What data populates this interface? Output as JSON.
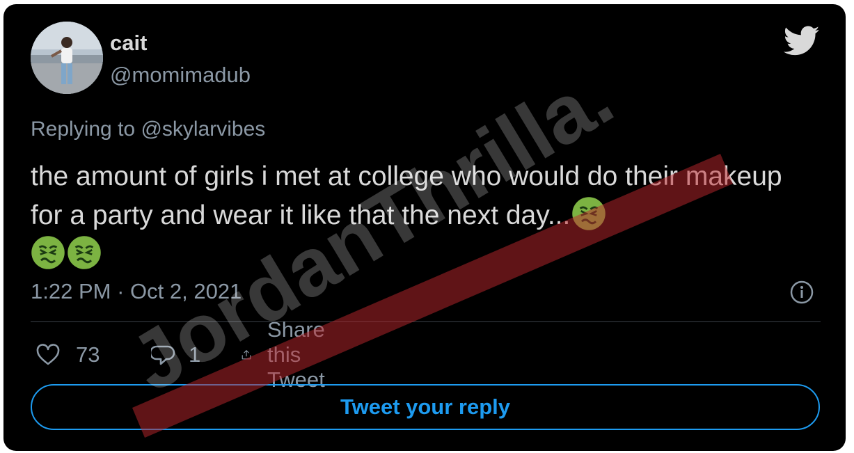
{
  "user": {
    "display_name": "cait",
    "handle": "@momimadub"
  },
  "tweet": {
    "replying_label": "Replying to",
    "replying_to": "@skylarvibes",
    "text": "the amount of girls i met at college who would do their makeup for a party and wear it like that the next day...",
    "emojis": [
      "nauseated-face",
      "nauseated-face",
      "nauseated-face"
    ],
    "time": "1:22 PM",
    "separator": "·",
    "date": "Oct 2, 2021"
  },
  "actions": {
    "likes": "73",
    "replies": "1",
    "share_label": "Share this Tweet"
  },
  "reply_button": {
    "label": "Tweet your reply"
  },
  "watermark": {
    "text": "JordanThrilla."
  },
  "colors": {
    "background": "#000000",
    "text": "#d9d9d9",
    "secondary": "#8b98a5",
    "accent": "#1d9bf0",
    "emoji": "#7cb342",
    "watermark_stripe": "#c0282d"
  },
  "icons": [
    "twitter-bird-icon",
    "info-icon",
    "heart-icon",
    "comment-icon",
    "share-icon"
  ]
}
